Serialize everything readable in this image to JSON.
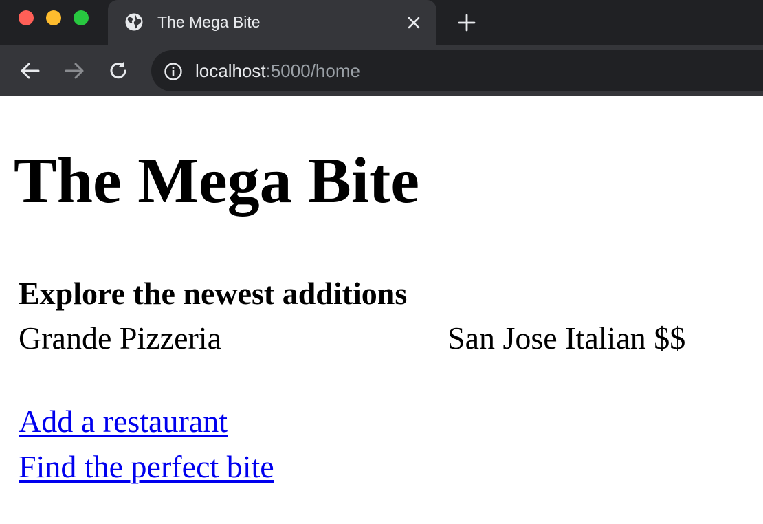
{
  "browser": {
    "tab_title": "The Mega Bite",
    "url_host": "localhost",
    "url_rest": ":5000/home",
    "colors": {
      "tabstrip_bg": "#202124",
      "toolbar_bg": "#35363a",
      "omnibox_bg": "#202124",
      "traffic_close": "#ff5f57",
      "traffic_min": "#febc2e",
      "traffic_max": "#28c840"
    },
    "icons": [
      "globe-icon",
      "close-icon",
      "plus-icon",
      "back-arrow-icon",
      "forward-arrow-icon",
      "reload-icon",
      "info-icon"
    ]
  },
  "page": {
    "title": "The Mega Bite",
    "section_heading": "Explore the newest additions",
    "restaurants": [
      {
        "name": "Grande Pizzeria",
        "details": "San Jose Italian $$"
      }
    ],
    "links": {
      "add_restaurant": "Add a restaurant",
      "find_bite": "Find the perfect bite"
    },
    "colors": {
      "link": "#0000ee",
      "text": "#000000"
    }
  }
}
